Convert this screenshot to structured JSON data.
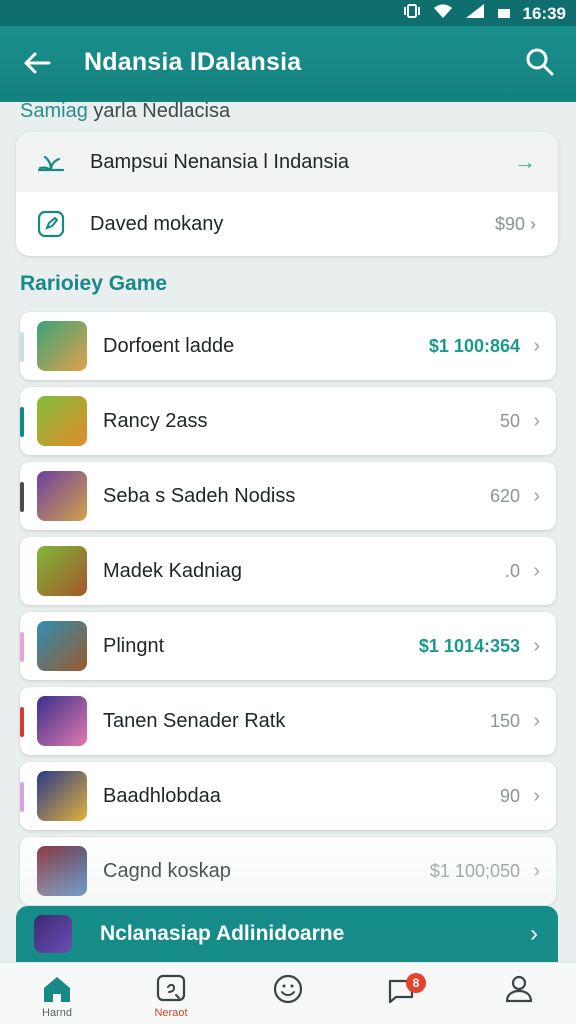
{
  "status_bar": {
    "time": "16:39"
  },
  "app_bar": {
    "title": "Ndansia lDalansia"
  },
  "top_section": {
    "title_accent": "Samiag",
    "title_rest": " yarla Nedlacisa",
    "rows": [
      {
        "label": "Bampsui Nenansia l Indansia",
        "right": "→"
      },
      {
        "label": "Daved mokany",
        "right": "$90"
      }
    ]
  },
  "games_section": {
    "title": "Rarioiey Game",
    "items": [
      {
        "name": "Dorfoent ladde",
        "value": "$1 100:864",
        "highlight": true,
        "stripe": "#c9dfe6",
        "thumb": [
          "#3aa37a",
          "#e0a24a"
        ]
      },
      {
        "name": "Rancy 2ass",
        "value": "50",
        "highlight": false,
        "stripe": "#0e8b86",
        "thumb": [
          "#7fbf3a",
          "#e38a2a"
        ]
      },
      {
        "name": "Seba s Sadeh Nodiss",
        "value": "620",
        "highlight": false,
        "stripe": "#4a4a4a",
        "thumb": [
          "#6c3fa0",
          "#d3a24a"
        ]
      },
      {
        "name": "Madek Kadniag",
        "value": ".0",
        "highlight": false,
        "stripe": "",
        "thumb": [
          "#7fb83a",
          "#a3552a"
        ]
      },
      {
        "name": "Plingnt",
        "value": "$1 1014:353",
        "highlight": true,
        "stripe": "#e6a3d9",
        "thumb": [
          "#2f8fb5",
          "#9a5a2a"
        ]
      },
      {
        "name": "Tanen Senader Ratk",
        "value": "150",
        "highlight": false,
        "stripe": "#d63a2a",
        "thumb": [
          "#3a2f8a",
          "#e07ab0"
        ]
      },
      {
        "name": "Baadhlobdaa",
        "value": "90",
        "highlight": false,
        "stripe": "#d7a2e0",
        "thumb": [
          "#2a3a8a",
          "#e0b23a"
        ]
      },
      {
        "name": "Cagnd koskap",
        "value": "$1 100;050",
        "highlight": false,
        "stripe": "",
        "thumb": [
          "#8a2a2a",
          "#2a6ab0"
        ]
      }
    ]
  },
  "promo": {
    "label": "Nclanasiap Adlinidoarne"
  },
  "nav": [
    {
      "label": "Harnd",
      "icon": "home-icon",
      "active": true
    },
    {
      "label": "Neraot",
      "icon": "chat-icon",
      "active": false
    },
    {
      "label": "",
      "icon": "smiley-icon",
      "active": false
    },
    {
      "label": "",
      "icon": "messages-icon",
      "active": false,
      "badge": "8"
    },
    {
      "label": "",
      "icon": "profile-icon",
      "active": false
    }
  ]
}
